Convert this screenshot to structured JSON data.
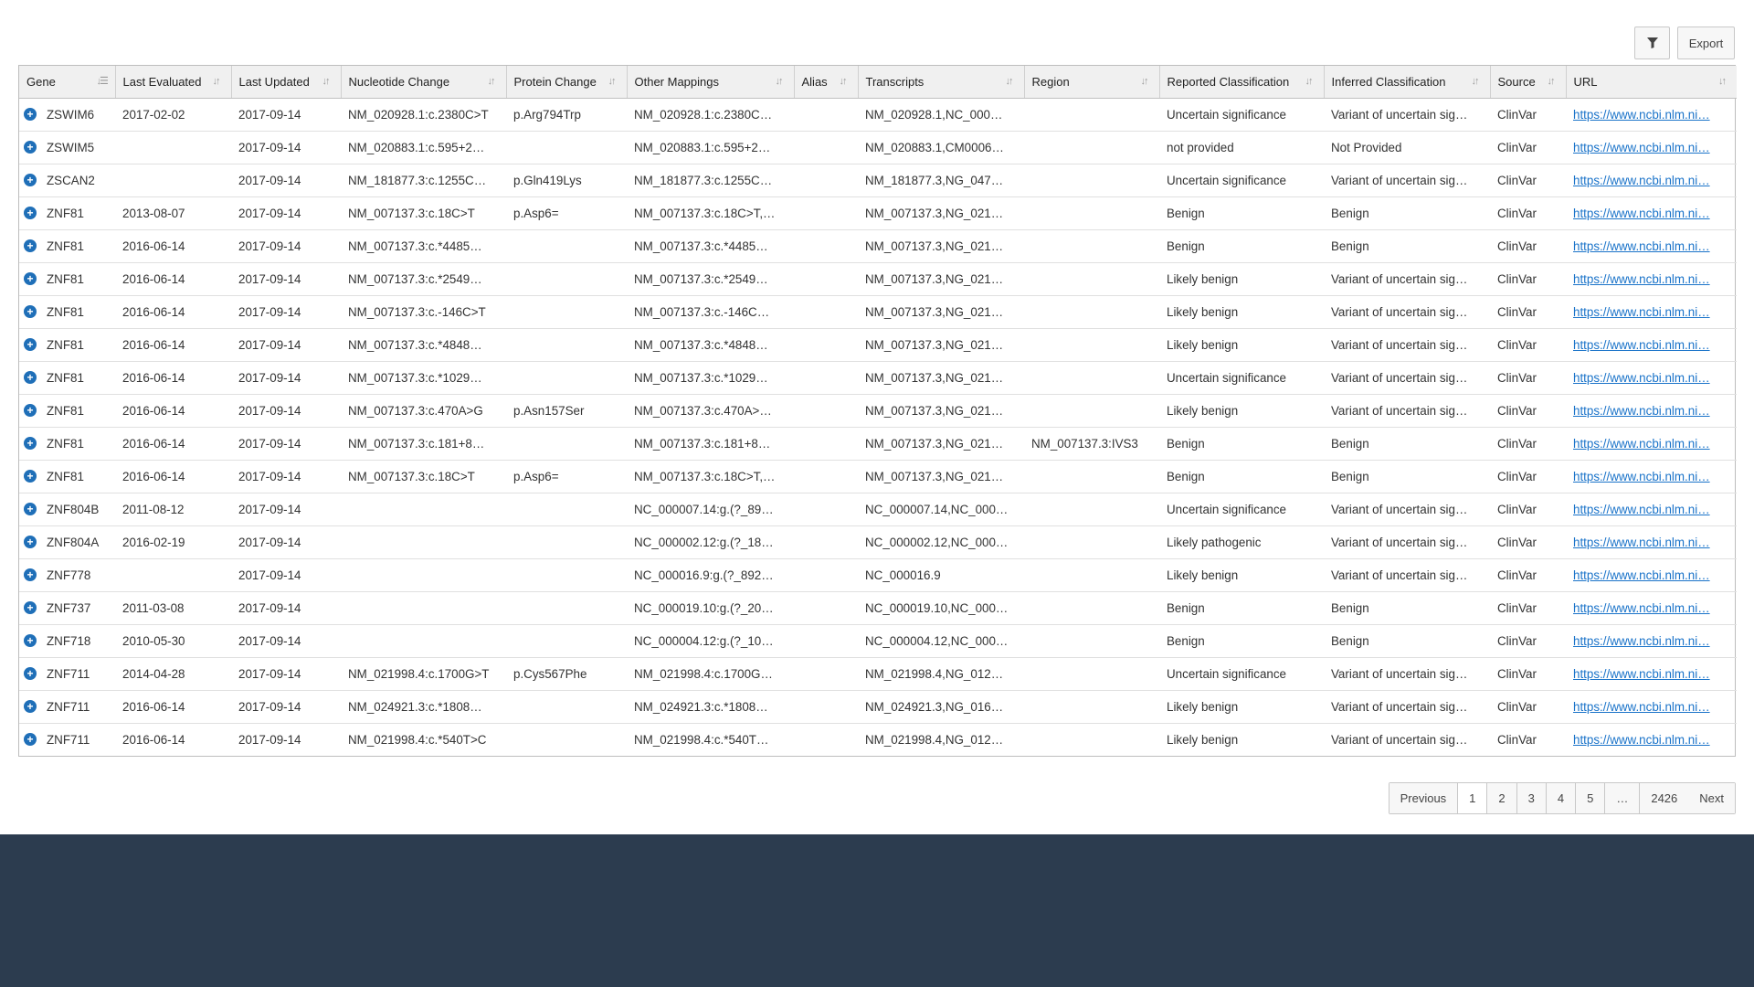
{
  "toolbar": {
    "filter_icon": "filter-icon",
    "export_label": "Export"
  },
  "columns": [
    {
      "label": "Gene",
      "sort": "sort-desc-icon"
    },
    {
      "label": "Last Evaluated",
      "sort": "sort-icon"
    },
    {
      "label": "Last Updated",
      "sort": "sort-icon"
    },
    {
      "label": "Nucleotide Change",
      "sort": "sort-icon"
    },
    {
      "label": "Protein Change",
      "sort": "sort-icon"
    },
    {
      "label": "Other Mappings",
      "sort": "sort-icon"
    },
    {
      "label": "Alias",
      "sort": "sort-icon"
    },
    {
      "label": "Transcripts",
      "sort": "sort-icon"
    },
    {
      "label": "Region",
      "sort": "sort-icon"
    },
    {
      "label": "Reported Classification",
      "sort": "sort-icon"
    },
    {
      "label": "Inferred Classification",
      "sort": "sort-icon"
    },
    {
      "label": "Source",
      "sort": "sort-icon"
    },
    {
      "label": "URL",
      "sort": "sort-icon"
    }
  ],
  "rows": [
    [
      "ZSWIM6",
      "2017-02-02",
      "2017-09-14",
      "NM_020928.1:c.2380C>T",
      "p.Arg794Trp",
      "NM_020928.1:c.2380C…",
      "",
      "NM_020928.1,NC_000…",
      "",
      "Uncertain significance",
      "Variant of uncertain sig…",
      "ClinVar",
      "https://www.ncbi.nlm.ni…"
    ],
    [
      "ZSWIM5",
      "",
      "2017-09-14",
      "NM_020883.1:c.595+2…",
      "",
      "NM_020883.1:c.595+2…",
      "",
      "NM_020883.1,CM0006…",
      "",
      "not provided",
      "Not Provided",
      "ClinVar",
      "https://www.ncbi.nlm.ni…"
    ],
    [
      "ZSCAN2",
      "",
      "2017-09-14",
      "NM_181877.3:c.1255C…",
      "p.Gln419Lys",
      "NM_181877.3:c.1255C…",
      "",
      "NM_181877.3,NG_047…",
      "",
      "Uncertain significance",
      "Variant of uncertain sig…",
      "ClinVar",
      "https://www.ncbi.nlm.ni…"
    ],
    [
      "ZNF81",
      "2013-08-07",
      "2017-09-14",
      "NM_007137.3:c.18C>T",
      "p.Asp6=",
      "NM_007137.3:c.18C>T,…",
      "",
      "NM_007137.3,NG_021…",
      "",
      "Benign",
      "Benign",
      "ClinVar",
      "https://www.ncbi.nlm.ni…"
    ],
    [
      "ZNF81",
      "2016-06-14",
      "2017-09-14",
      "NM_007137.3:c.*4485…",
      "",
      "NM_007137.3:c.*4485…",
      "",
      "NM_007137.3,NG_021…",
      "",
      "Benign",
      "Benign",
      "ClinVar",
      "https://www.ncbi.nlm.ni…"
    ],
    [
      "ZNF81",
      "2016-06-14",
      "2017-09-14",
      "NM_007137.3:c.*2549…",
      "",
      "NM_007137.3:c.*2549…",
      "",
      "NM_007137.3,NG_021…",
      "",
      "Likely benign",
      "Variant of uncertain sig…",
      "ClinVar",
      "https://www.ncbi.nlm.ni…"
    ],
    [
      "ZNF81",
      "2016-06-14",
      "2017-09-14",
      "NM_007137.3:c.-146C>T",
      "",
      "NM_007137.3:c.-146C…",
      "",
      "NM_007137.3,NG_021…",
      "",
      "Likely benign",
      "Variant of uncertain sig…",
      "ClinVar",
      "https://www.ncbi.nlm.ni…"
    ],
    [
      "ZNF81",
      "2016-06-14",
      "2017-09-14",
      "NM_007137.3:c.*4848…",
      "",
      "NM_007137.3:c.*4848…",
      "",
      "NM_007137.3,NG_021…",
      "",
      "Likely benign",
      "Variant of uncertain sig…",
      "ClinVar",
      "https://www.ncbi.nlm.ni…"
    ],
    [
      "ZNF81",
      "2016-06-14",
      "2017-09-14",
      "NM_007137.3:c.*1029…",
      "",
      "NM_007137.3:c.*1029…",
      "",
      "NM_007137.3,NG_021…",
      "",
      "Uncertain significance",
      "Variant of uncertain sig…",
      "ClinVar",
      "https://www.ncbi.nlm.ni…"
    ],
    [
      "ZNF81",
      "2016-06-14",
      "2017-09-14",
      "NM_007137.3:c.470A>G",
      "p.Asn157Ser",
      "NM_007137.3:c.470A>…",
      "",
      "NM_007137.3,NG_021…",
      "",
      "Likely benign",
      "Variant of uncertain sig…",
      "ClinVar",
      "https://www.ncbi.nlm.ni…"
    ],
    [
      "ZNF81",
      "2016-06-14",
      "2017-09-14",
      "NM_007137.3:c.181+8…",
      "",
      "NM_007137.3:c.181+8…",
      "",
      "NM_007137.3,NG_021…",
      "NM_007137.3:IVS3",
      "Benign",
      "Benign",
      "ClinVar",
      "https://www.ncbi.nlm.ni…"
    ],
    [
      "ZNF81",
      "2016-06-14",
      "2017-09-14",
      "NM_007137.3:c.18C>T",
      "p.Asp6=",
      "NM_007137.3:c.18C>T,…",
      "",
      "NM_007137.3,NG_021…",
      "",
      "Benign",
      "Benign",
      "ClinVar",
      "https://www.ncbi.nlm.ni…"
    ],
    [
      "ZNF804B",
      "2011-08-12",
      "2017-09-14",
      "",
      "",
      "NC_000007.14:g.(?_89…",
      "",
      "NC_000007.14,NC_000…",
      "",
      "Uncertain significance",
      "Variant of uncertain sig…",
      "ClinVar",
      "https://www.ncbi.nlm.ni…"
    ],
    [
      "ZNF804A",
      "2016-02-19",
      "2017-09-14",
      "",
      "",
      "NC_000002.12:g.(?_18…",
      "",
      "NC_000002.12,NC_000…",
      "",
      "Likely pathogenic",
      "Variant of uncertain sig…",
      "ClinVar",
      "https://www.ncbi.nlm.ni…"
    ],
    [
      "ZNF778",
      "",
      "2017-09-14",
      "",
      "",
      "NC_000016.9:g.(?_892…",
      "",
      "NC_000016.9",
      "",
      "Likely benign",
      "Variant of uncertain sig…",
      "ClinVar",
      "https://www.ncbi.nlm.ni…"
    ],
    [
      "ZNF737",
      "2011-03-08",
      "2017-09-14",
      "",
      "",
      "NC_000019.10:g.(?_20…",
      "",
      "NC_000019.10,NC_000…",
      "",
      "Benign",
      "Benign",
      "ClinVar",
      "https://www.ncbi.nlm.ni…"
    ],
    [
      "ZNF718",
      "2010-05-30",
      "2017-09-14",
      "",
      "",
      "NC_000004.12:g.(?_10…",
      "",
      "NC_000004.12,NC_000…",
      "",
      "Benign",
      "Benign",
      "ClinVar",
      "https://www.ncbi.nlm.ni…"
    ],
    [
      "ZNF711",
      "2014-04-28",
      "2017-09-14",
      "NM_021998.4:c.1700G>T",
      "p.Cys567Phe",
      "NM_021998.4:c.1700G…",
      "",
      "NM_021998.4,NG_012…",
      "",
      "Uncertain significance",
      "Variant of uncertain sig…",
      "ClinVar",
      "https://www.ncbi.nlm.ni…"
    ],
    [
      "ZNF711",
      "2016-06-14",
      "2017-09-14",
      "NM_024921.3:c.*1808…",
      "",
      "NM_024921.3:c.*1808…",
      "",
      "NM_024921.3,NG_016…",
      "",
      "Likely benign",
      "Variant of uncertain sig…",
      "ClinVar",
      "https://www.ncbi.nlm.ni…"
    ],
    [
      "ZNF711",
      "2016-06-14",
      "2017-09-14",
      "NM_021998.4:c.*540T>C",
      "",
      "NM_021998.4:c.*540T…",
      "",
      "NM_021998.4,NG_012…",
      "",
      "Likely benign",
      "Variant of uncertain sig…",
      "ClinVar",
      "https://www.ncbi.nlm.ni…"
    ]
  ],
  "pagination": {
    "previous": "Previous",
    "pages": [
      "1",
      "2",
      "3",
      "4",
      "5",
      "…",
      "2426"
    ],
    "current": "1",
    "next": "Next"
  },
  "colors": {
    "link": "#1a73c9",
    "expand_icon": "#1f6fb8",
    "footer_band": "#2c3c4f"
  }
}
